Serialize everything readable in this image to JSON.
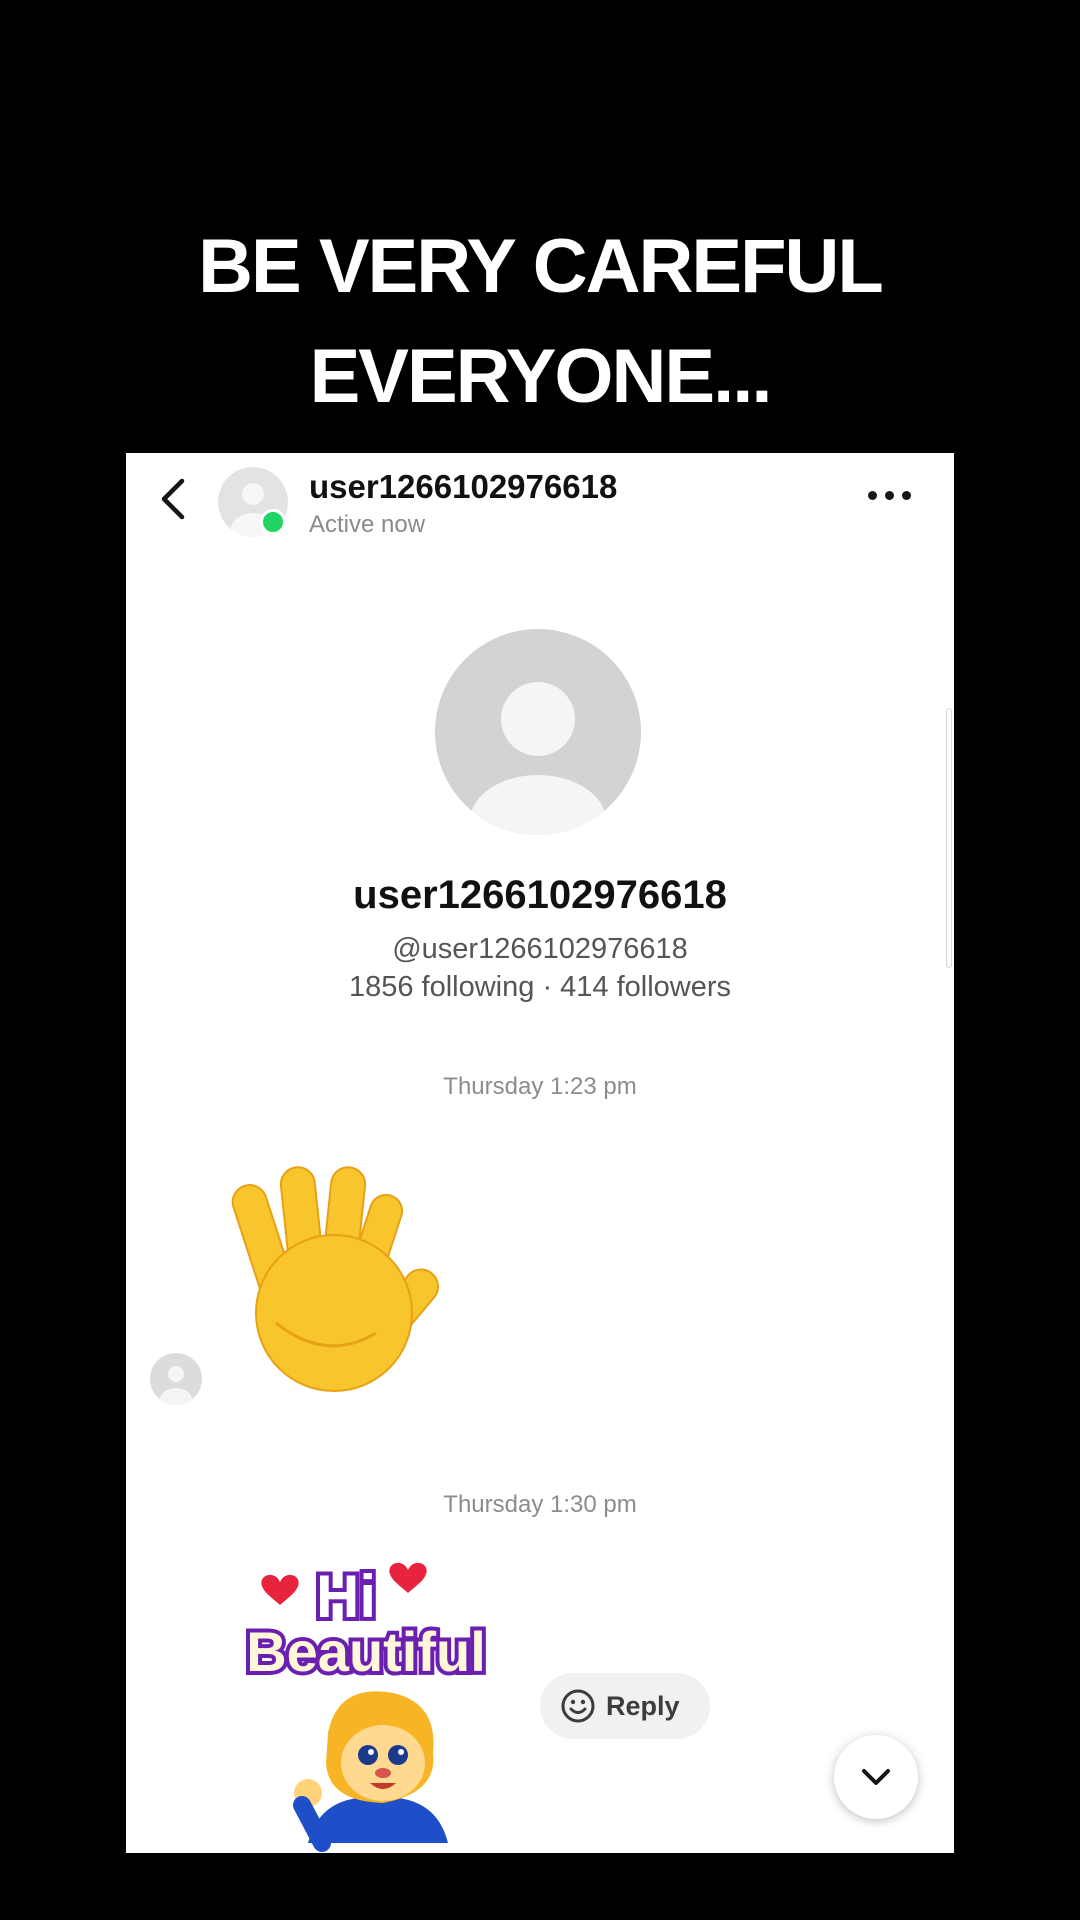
{
  "caption": {
    "line1": "BE VERY CAREFUL",
    "line2": "EVERYONE..."
  },
  "header": {
    "username": "user1266102976618",
    "status": "Active now"
  },
  "profile": {
    "display_name": "user1266102976618",
    "handle": "@user1266102976618",
    "stats": "1856 following · 414 followers"
  },
  "messages": [
    {
      "timestamp": "Thursday 1:23 pm",
      "content": "waving-hand-emoji"
    },
    {
      "timestamp": "Thursday 1:30 pm",
      "content": "hi-beautiful-sticker"
    }
  ],
  "sticker": {
    "text_top": "Hi",
    "text_bottom": "Beautiful"
  },
  "reply_button": {
    "label": "Reply"
  },
  "colors": {
    "online": "#22d463",
    "sticker_purple": "#6a1fb0",
    "heart": "#e8233d"
  },
  "icons": {
    "back": "chevron-left-icon",
    "more": "more-horizontal-icon",
    "emoji": "smiley-icon",
    "scroll_down": "chevron-down-icon"
  }
}
